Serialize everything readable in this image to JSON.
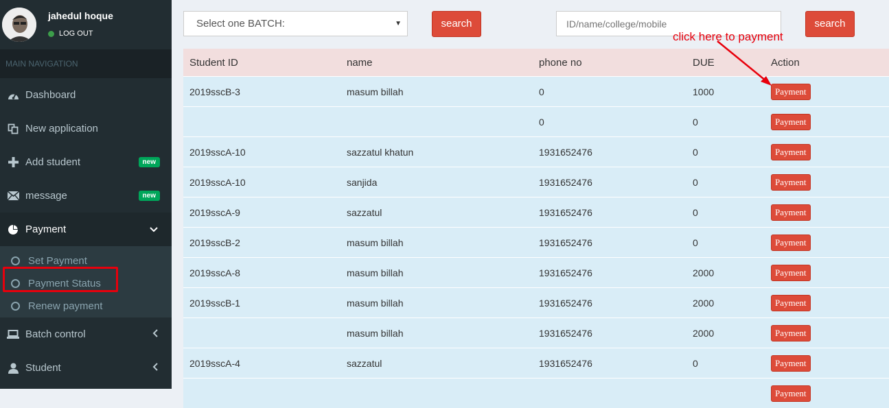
{
  "user": {
    "name": "jahedul hoque",
    "status": "LOG OUT"
  },
  "nav": {
    "header": "MAIN NAVIGATION",
    "items": [
      {
        "label": "Dashboard",
        "icon": "dashboard-icon"
      },
      {
        "label": "New application",
        "icon": "copy-icon"
      },
      {
        "label": "Add student",
        "icon": "plus-icon",
        "badge": "new"
      },
      {
        "label": "message",
        "icon": "envelope-icon",
        "badge": "new"
      },
      {
        "label": "Payment",
        "icon": "pie-chart-icon"
      }
    ],
    "payment_sub": [
      "Set Payment",
      "Payment Status",
      "Renew payment"
    ],
    "after": [
      {
        "label": "Batch control",
        "icon": "laptop-icon"
      },
      {
        "label": "Student",
        "icon": "user-icon"
      }
    ]
  },
  "toolbar": {
    "batch_select": "Select one BATCH:",
    "search1": "search",
    "search_placeholder": "ID/name/college/mobile",
    "search2": "search"
  },
  "annotation": "click here to payment",
  "table": {
    "headers": [
      "Student ID",
      "name",
      "phone no",
      "DUE",
      "Action"
    ],
    "rows": [
      [
        "2019sscB-3",
        "masum billah",
        "0",
        "1000",
        "Payment"
      ],
      [
        "",
        "",
        "0",
        "0",
        "Payment"
      ],
      [
        "2019sscA-10",
        "sazzatul khatun",
        "1931652476",
        "0",
        "Payment"
      ],
      [
        "2019sscA-10",
        "sanjida",
        "1931652476",
        "0",
        "Payment"
      ],
      [
        "2019sscA-9",
        "sazzatul",
        "1931652476",
        "0",
        "Payment"
      ],
      [
        "2019sscB-2",
        "masum billah",
        "1931652476",
        "0",
        "Payment"
      ],
      [
        "2019sscA-8",
        "masum billah",
        "1931652476",
        "2000",
        "Payment"
      ],
      [
        "2019sscB-1",
        "masum billah",
        "1931652476",
        "2000",
        "Payment"
      ],
      [
        "",
        "masum billah",
        "1931652476",
        "2000",
        "Payment"
      ],
      [
        "2019sscA-4",
        "sazzatul",
        "1931652476",
        "0",
        "Payment"
      ],
      [
        "",
        "",
        "",
        "",
        "Payment"
      ]
    ]
  },
  "colors": {
    "accent": "#dd4b39",
    "sidebar": "#222d32",
    "header_row": "#f2dede",
    "row": "#d9edf7",
    "annotation": "#e8000c"
  }
}
